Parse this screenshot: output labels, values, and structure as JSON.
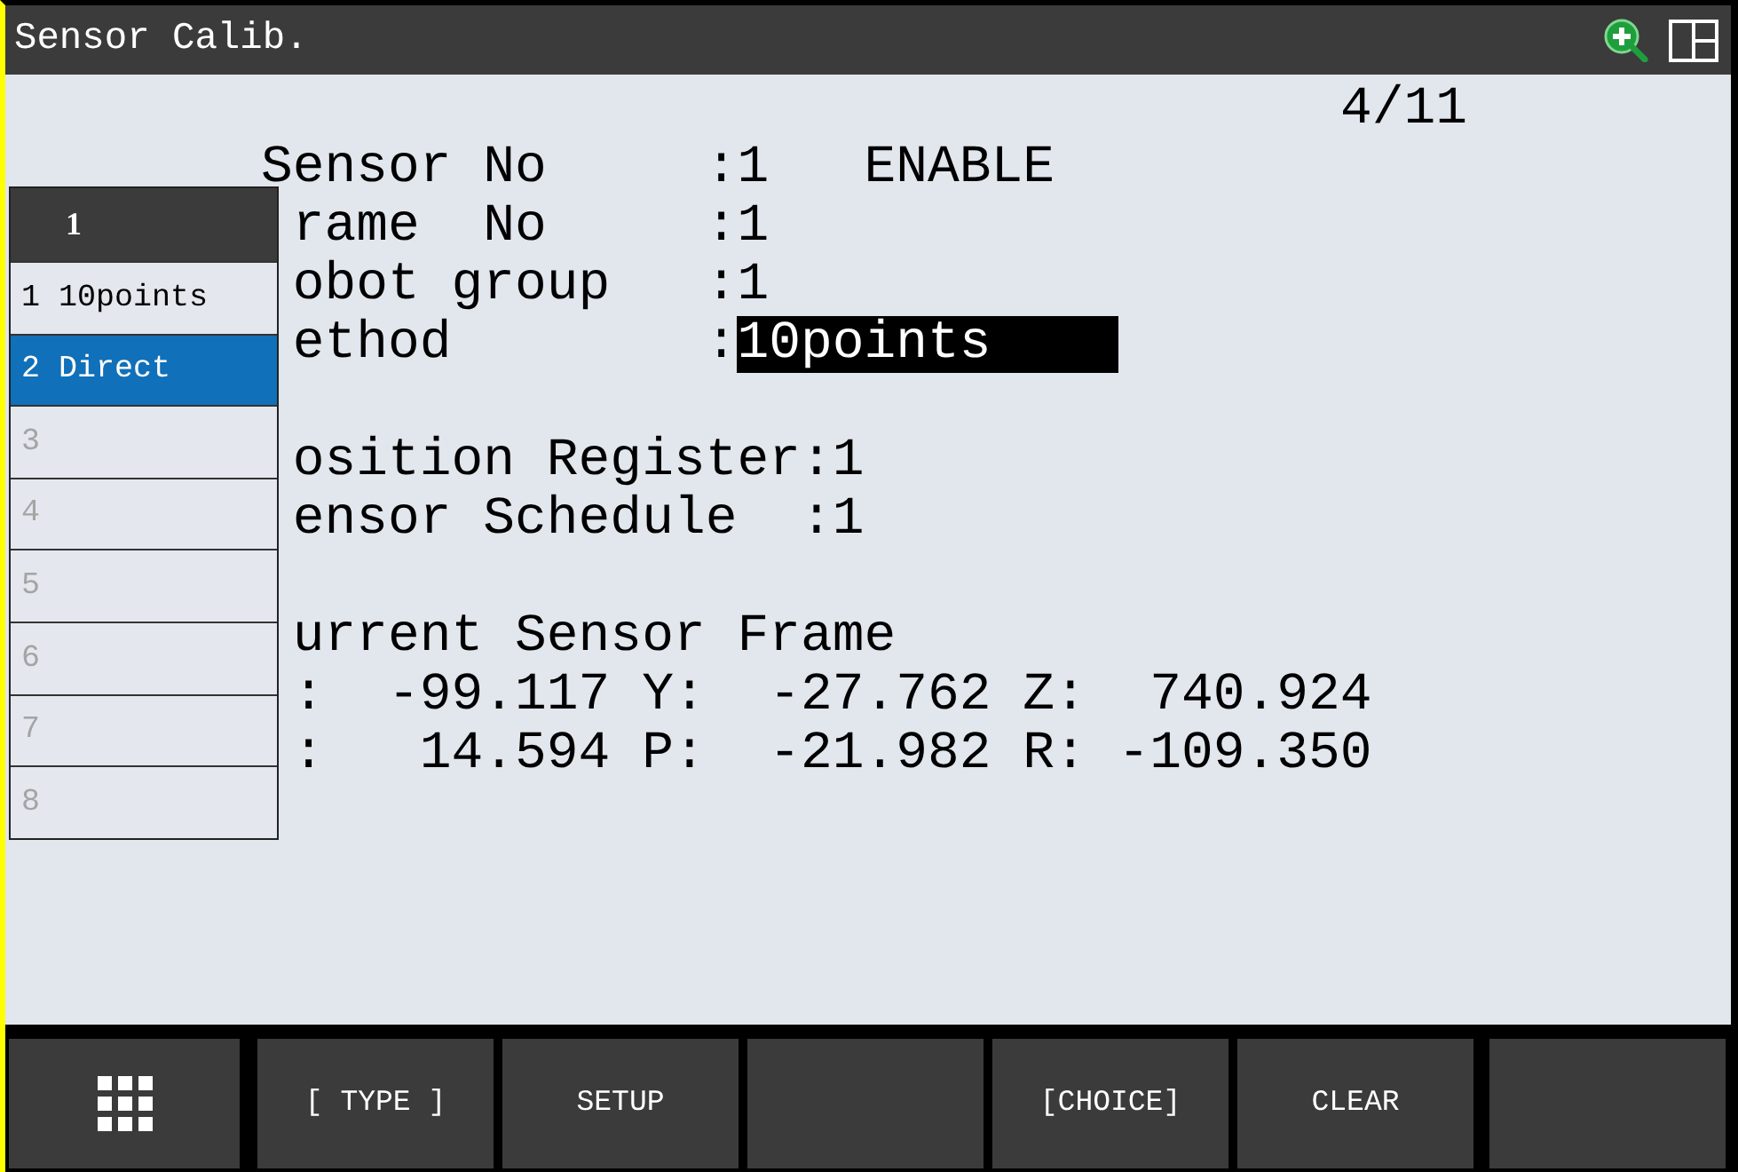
{
  "title_bar": {
    "title": "Sensor Calib."
  },
  "page": "4/11",
  "setup_fields": [
    {
      "kind": "value",
      "label": "Sensor No",
      "covered": false,
      "value": ":1",
      "status": "ENABLE"
    },
    {
      "kind": "value",
      "label": "rame  No",
      "covered": true,
      "value": ":1"
    },
    {
      "kind": "value",
      "label": "obot group",
      "covered": true,
      "value": ":1"
    },
    {
      "kind": "choice",
      "label": "ethod",
      "covered": true,
      "separator": ":",
      "value": "10points"
    }
  ],
  "register_fields": [
    {
      "kind": "value",
      "label": "osition Register",
      "covered": true,
      "value": ":1"
    },
    {
      "kind": "value",
      "label": "ensor Schedule",
      "covered": true,
      "value": ":1"
    }
  ],
  "current_frame": {
    "title": "urrent Sensor Frame",
    "covered": true,
    "rows": [
      [
        {
          "axis": ":",
          "covered": true,
          "value": "-99.117"
        },
        {
          "axis": "Y:",
          "covered": false,
          "value": "-27.762"
        },
        {
          "axis": "Z:",
          "covered": false,
          "value": "740.924"
        }
      ],
      [
        {
          "axis": ":",
          "covered": true,
          "value": "14.594"
        },
        {
          "axis": "P:",
          "covered": false,
          "value": "-21.982"
        },
        {
          "axis": "R:",
          "covered": false,
          "value": "-109.350"
        }
      ]
    ]
  },
  "choice_menu": {
    "title": "1",
    "items": [
      {
        "text": "1 10points",
        "selected": false,
        "disabled": false
      },
      {
        "text": "2 Direct",
        "selected": true,
        "disabled": false
      },
      {
        "text": "3",
        "selected": false,
        "disabled": true
      },
      {
        "text": "4",
        "selected": false,
        "disabled": true
      },
      {
        "text": "5",
        "selected": false,
        "disabled": true
      },
      {
        "text": "6",
        "selected": false,
        "disabled": true
      },
      {
        "text": "7",
        "selected": false,
        "disabled": true
      },
      {
        "text": "8",
        "selected": false,
        "disabled": true
      }
    ]
  },
  "function_keys": [
    {
      "kind": "labeled",
      "label": "[ TYPE ]"
    },
    {
      "kind": "labeled",
      "label": "SETUP"
    },
    {
      "kind": "blank"
    },
    {
      "kind": "labeled",
      "label": "[CHOICE]"
    },
    {
      "kind": "labeled",
      "label": "CLEAR"
    },
    {
      "kind": "blank"
    }
  ]
}
